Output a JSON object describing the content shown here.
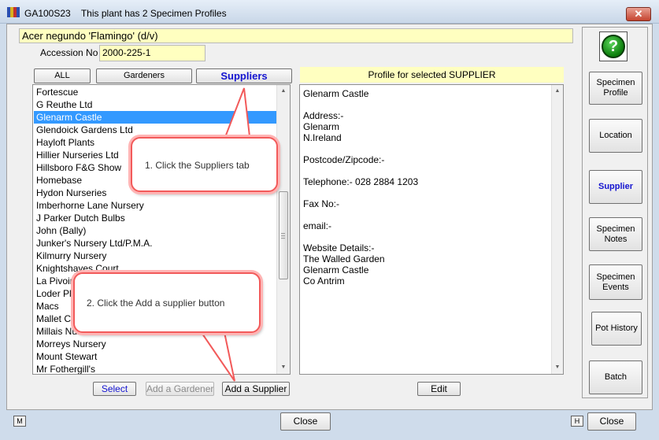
{
  "window": {
    "code": "GA100S23",
    "title": "This plant has 2 Specimen Profiles",
    "close_glyph": "✕"
  },
  "plant": {
    "name": "Acer negundo 'Flamingo' (d/v)",
    "accession_label": "Accession No",
    "accession_no": "2000-225-1"
  },
  "tabs": [
    {
      "label": "ALL"
    },
    {
      "label": "Gardeners"
    },
    {
      "label": "Suppliers",
      "active": true
    }
  ],
  "suppliers": [
    "Fortescue",
    "G Reuthe Ltd",
    "Glenarm Castle",
    "Glendoick Gardens Ltd",
    "Hayloft Plants",
    "Hillier Nurseries Ltd",
    "Hillsboro F&G Show",
    "Homebase",
    "Hydon Nurseries",
    "Imberhorne Lane Nursery",
    "J Parker Dutch Bulbs",
    "John (Bally)",
    "Junker's Nursery Ltd/P.M.A.",
    "Kilmurry Nursery",
    "Knightshayes Court",
    "La Pivoine",
    "Loder Plants",
    "Macs",
    "Mallet Court",
    "Millais Nurseries",
    "Morreys Nursery",
    "Mount Stewart",
    "Mr Fothergill's"
  ],
  "selected_supplier": "Glenarm Castle",
  "list_buttons": {
    "select": "Select",
    "add_gardener": "Add a Gardener",
    "add_supplier": "Add a Supplier"
  },
  "profile": {
    "header": "Profile for selected SUPPLIER",
    "text": "Glenarm Castle\n\nAddress:-\nGlenarm\nN.Ireland\n\nPostcode/Zipcode:-\n\nTelephone:- 028 2884 1203\n\nFax No:-\n\nemail:-\n\nWebsite Details:-\nThe Walled Garden\nGlenarm Castle\nCo Antrim",
    "edit_label": "Edit"
  },
  "side_buttons": [
    {
      "label": "Specimen Profile"
    },
    {
      "label": "Location"
    },
    {
      "label": "Supplier",
      "active": true
    },
    {
      "label": "Specimen Notes"
    },
    {
      "label": "Specimen Events"
    },
    {
      "label": "Pot History"
    },
    {
      "label": "Batch"
    }
  ],
  "help_glyph": "?",
  "callouts": [
    {
      "text": "1. Click the Suppliers tab"
    },
    {
      "text": "2. Click the Add a supplier button"
    }
  ],
  "bottom": {
    "m_label": "M",
    "h_label": "H",
    "close_label": "Close",
    "close_label_right": "Close"
  },
  "colors": {
    "accent_blue": "#1414d0",
    "selection": "#3399ff",
    "field_yellow": "#ffffc0",
    "callout_border": "#f25a5a"
  }
}
